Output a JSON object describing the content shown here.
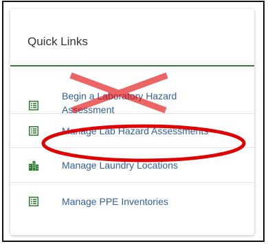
{
  "card": {
    "title": "Quick Links",
    "accent": "#2e7d32",
    "link_color": "#2f5f9e"
  },
  "links": [
    {
      "label": "Begin a Laboratory Hazard Assessment",
      "icon": "list-form-icon",
      "struck_out": true
    },
    {
      "label": "Manage Lab Hazard Assessments",
      "icon": "list-form-icon",
      "circled": true
    },
    {
      "label": "Manage Laundry Locations",
      "icon": "building-icon"
    },
    {
      "label": "Manage PPE Inventories",
      "icon": "list-form-icon"
    }
  ],
  "annotation_color": "#e10000"
}
